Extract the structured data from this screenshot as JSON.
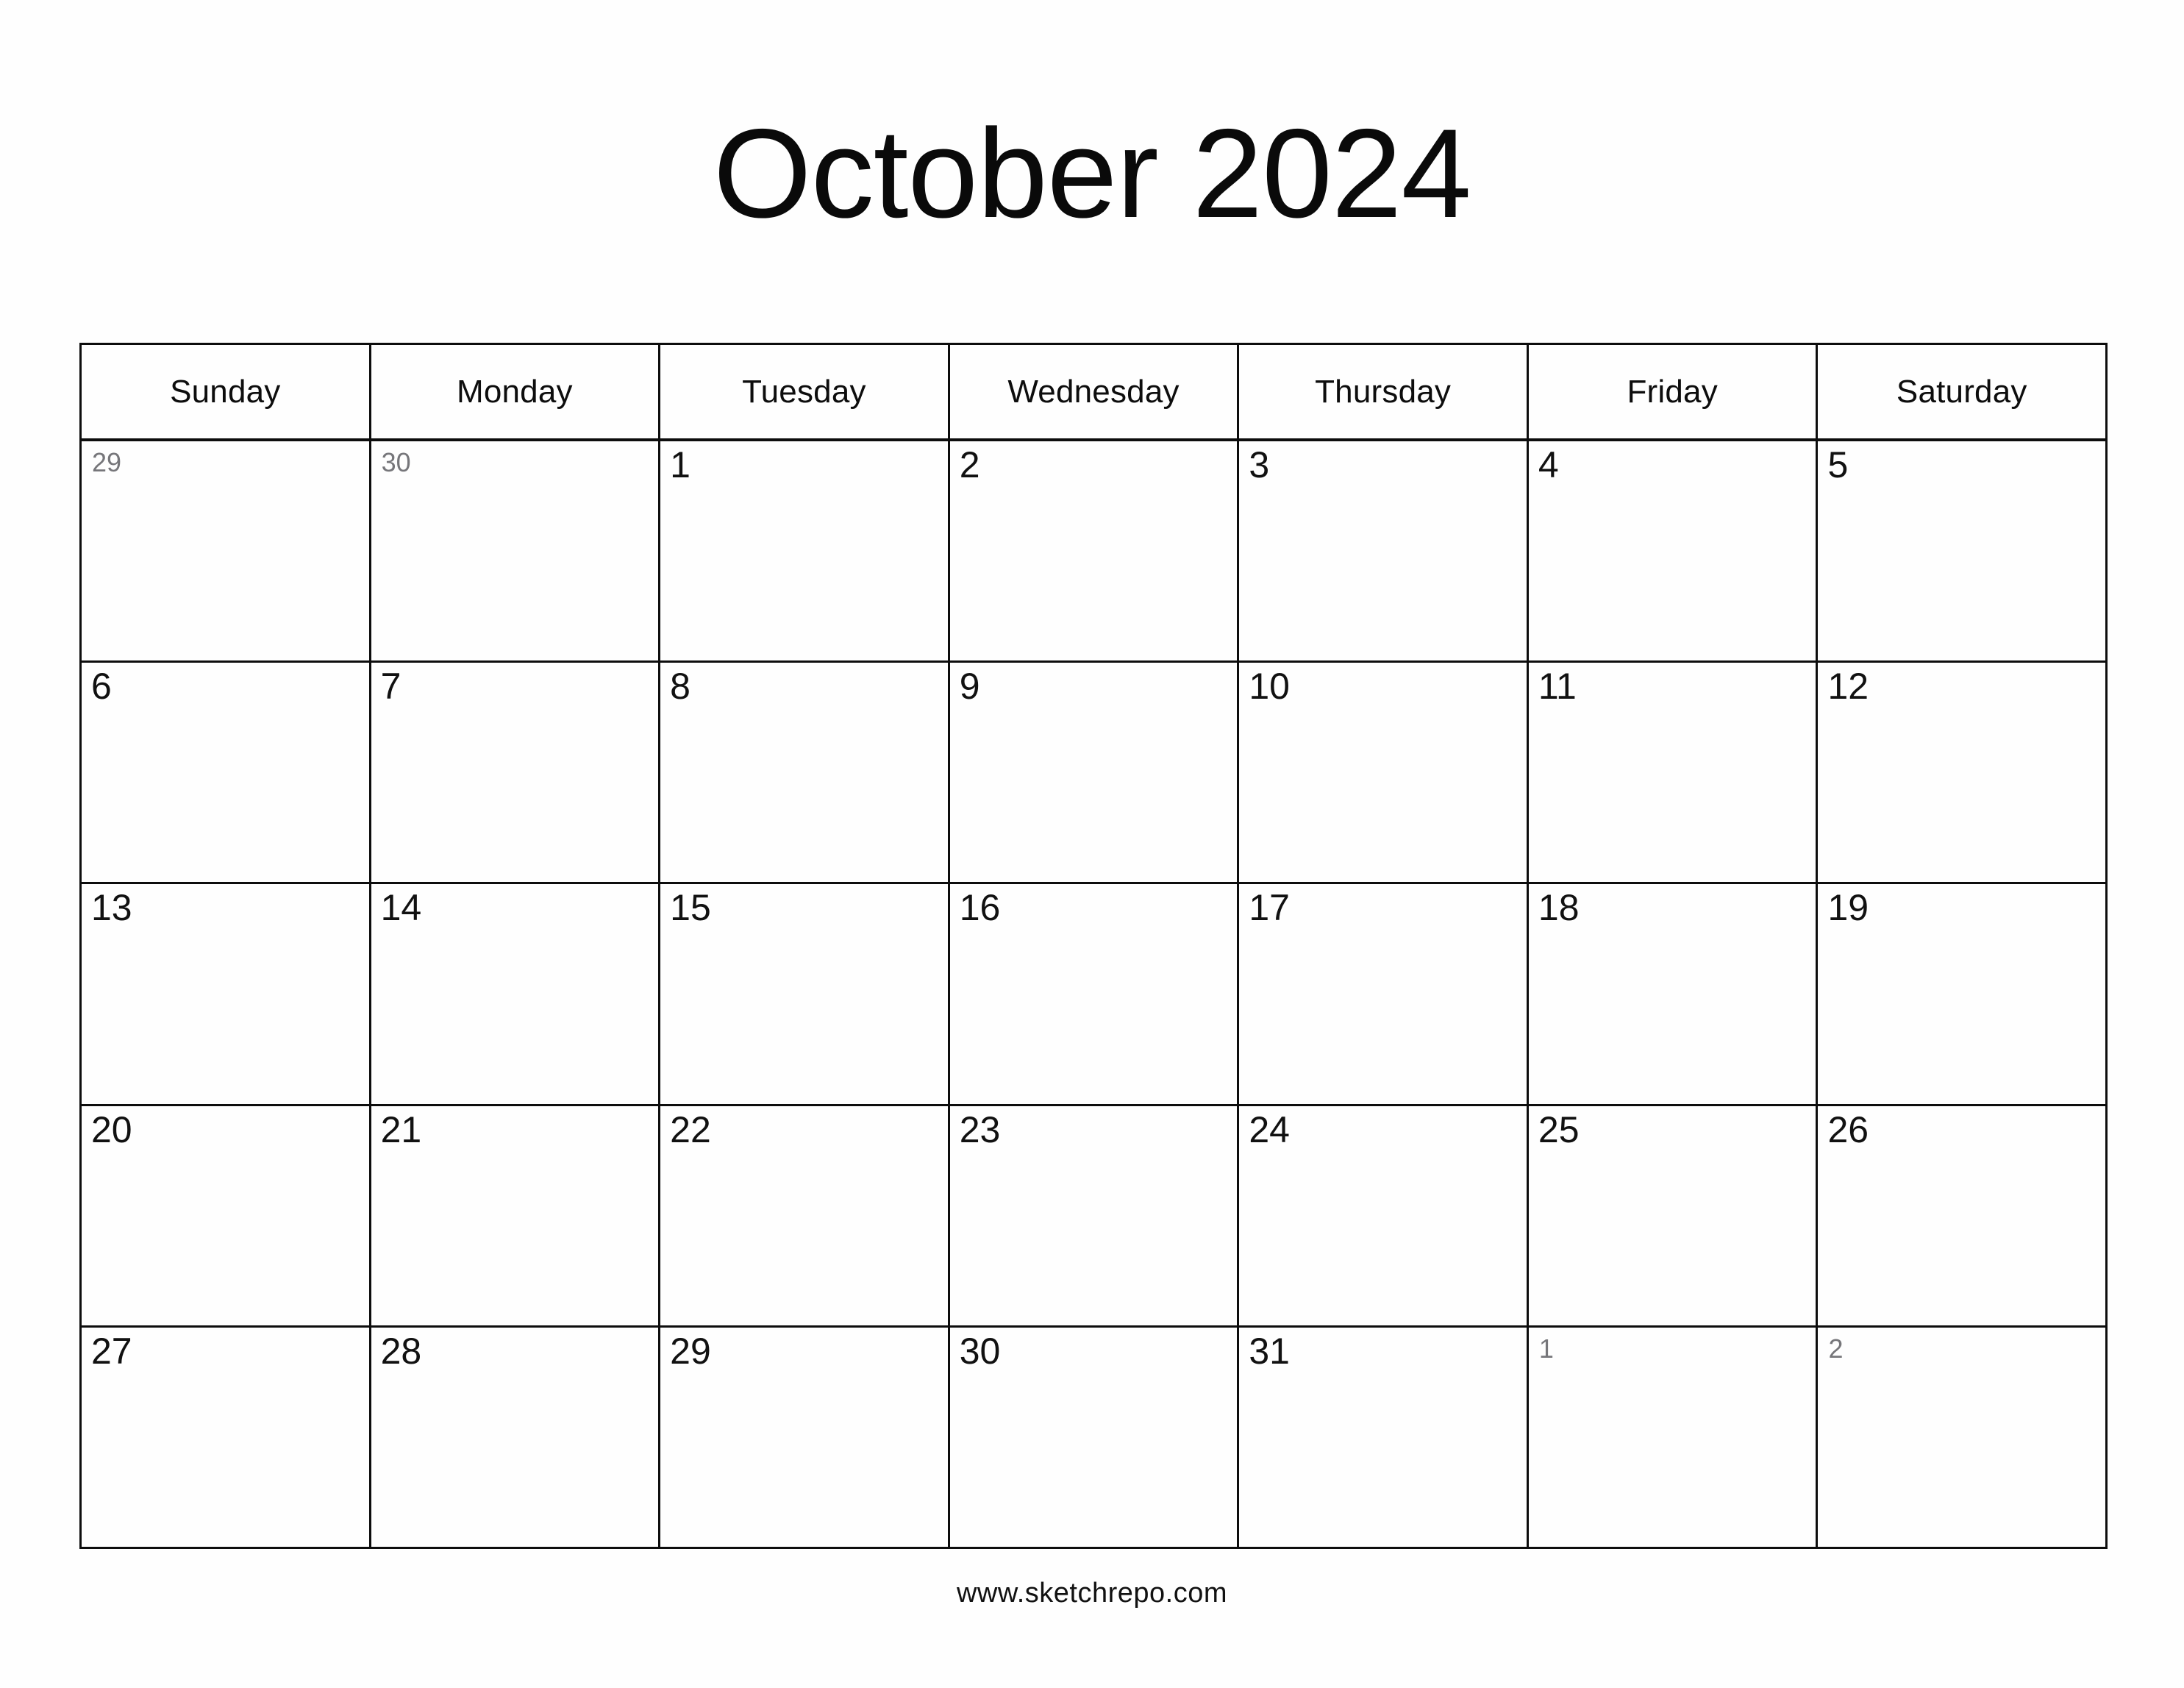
{
  "title": "October 2024",
  "weekdays": [
    "Sunday",
    "Monday",
    "Tuesday",
    "Wednesday",
    "Thursday",
    "Friday",
    "Saturday"
  ],
  "weeks": [
    [
      {
        "label": "29",
        "adjacent": true
      },
      {
        "label": "30",
        "adjacent": true
      },
      {
        "label": "1",
        "adjacent": false
      },
      {
        "label": "2",
        "adjacent": false
      },
      {
        "label": "3",
        "adjacent": false
      },
      {
        "label": "4",
        "adjacent": false
      },
      {
        "label": "5",
        "adjacent": false
      }
    ],
    [
      {
        "label": "6",
        "adjacent": false
      },
      {
        "label": "7",
        "adjacent": false
      },
      {
        "label": "8",
        "adjacent": false
      },
      {
        "label": "9",
        "adjacent": false
      },
      {
        "label": "10",
        "adjacent": false
      },
      {
        "label": "11",
        "adjacent": false
      },
      {
        "label": "12",
        "adjacent": false
      }
    ],
    [
      {
        "label": "13",
        "adjacent": false
      },
      {
        "label": "14",
        "adjacent": false
      },
      {
        "label": "15",
        "adjacent": false
      },
      {
        "label": "16",
        "adjacent": false
      },
      {
        "label": "17",
        "adjacent": false
      },
      {
        "label": "18",
        "adjacent": false
      },
      {
        "label": "19",
        "adjacent": false
      }
    ],
    [
      {
        "label": "20",
        "adjacent": false
      },
      {
        "label": "21",
        "adjacent": false
      },
      {
        "label": "22",
        "adjacent": false
      },
      {
        "label": "23",
        "adjacent": false
      },
      {
        "label": "24",
        "adjacent": false
      },
      {
        "label": "25",
        "adjacent": false
      },
      {
        "label": "26",
        "adjacent": false
      }
    ],
    [
      {
        "label": "27",
        "adjacent": false
      },
      {
        "label": "28",
        "adjacent": false
      },
      {
        "label": "29",
        "adjacent": false
      },
      {
        "label": "30",
        "adjacent": false
      },
      {
        "label": "31",
        "adjacent": false
      },
      {
        "label": "1",
        "adjacent": true
      },
      {
        "label": "2",
        "adjacent": true
      }
    ]
  ],
  "footer": "www.sketchrepo.com",
  "colors": {
    "background": "#fefefe",
    "grid_line": "#0d0d0d",
    "text": "#111111",
    "adjacent_text": "#76767a"
  }
}
